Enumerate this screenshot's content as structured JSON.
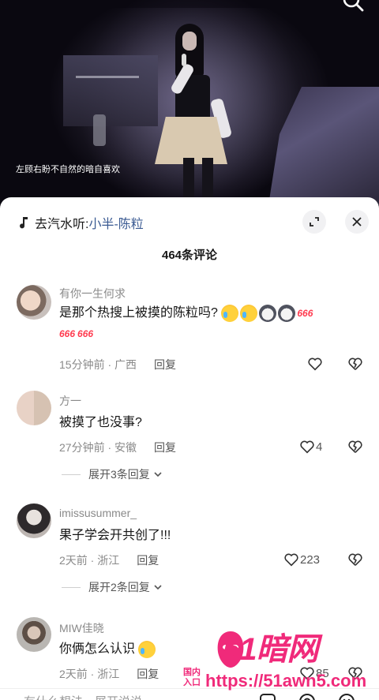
{
  "video": {
    "subtitle": "左顾右盼不自然的暗自喜欢"
  },
  "sheet": {
    "music_prefix": "去汽水听:",
    "music_title": "小半-陈粒",
    "comment_count": "464条评论"
  },
  "comments": [
    {
      "user": "有你一生何求",
      "text": "是那个热搜上被摸的陈粒吗?",
      "emoji_tags": [
        "666",
        "666",
        "666"
      ],
      "meta": "15分钟前 · 广西",
      "reply": "回复",
      "likes": ""
    },
    {
      "user": "方一",
      "text": "被摸了也没事?",
      "meta": "27分钟前 · 安徽",
      "reply": "回复",
      "likes": "4",
      "expand": "展开3条回复"
    },
    {
      "user": "imissusummer_",
      "text": "果子学会开共创了!!!",
      "meta": "2天前 · 浙江",
      "reply": "回复",
      "likes": "223",
      "expand": "展开2条回复"
    },
    {
      "user": "MIW佳晓",
      "text": "你俩怎么认识",
      "meta": "2天前 · 浙江",
      "reply": "回复",
      "likes": "85"
    }
  ],
  "input": {
    "placeholder": "有什么想法，展开说说"
  },
  "watermark": {
    "logo": "51暗网",
    "small": "国内入口",
    "url": "https://51awn5.com"
  }
}
